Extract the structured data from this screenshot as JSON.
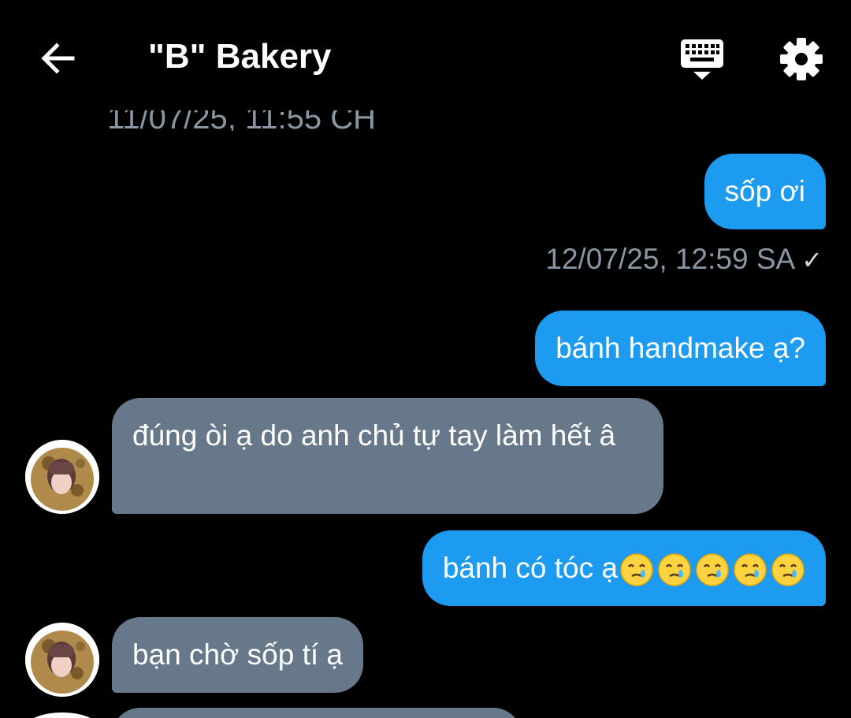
{
  "header": {
    "title": "\"B\" Bakery",
    "back_icon": "arrow-left-icon",
    "keyboard_icon": "keyboard-icon",
    "settings_icon": "gear-icon"
  },
  "messages": [
    {
      "type": "timestamp",
      "text": "11/07/25, 11:55 CH"
    },
    {
      "type": "outgoing",
      "text": "sốp ơi"
    },
    {
      "type": "timestamp",
      "text": "12/07/25, 12:59 SA",
      "status_icon": "check-icon"
    },
    {
      "type": "outgoing",
      "text": "bánh handmake ạ?"
    },
    {
      "type": "incoming",
      "text": "đúng òi ạ do anh chủ tự tay làm hết â",
      "avatar": "avatar"
    },
    {
      "type": "outgoing",
      "text": "bánh có tóc ạ",
      "emoji": [
        "face-holding-back-tears-icon",
        "face-holding-back-tears-icon",
        "face-holding-back-tears-icon",
        "face-holding-back-tears-icon",
        "face-holding-back-tears-icon"
      ]
    },
    {
      "type": "incoming",
      "text": "bạn chờ sốp tí ạ",
      "avatar": "avatar"
    }
  ],
  "colors": {
    "background": "#000000",
    "outgoing_bubble": "#1d9bf0",
    "incoming_bubble": "#67788a",
    "timestamp_text": "#8a96a3"
  }
}
